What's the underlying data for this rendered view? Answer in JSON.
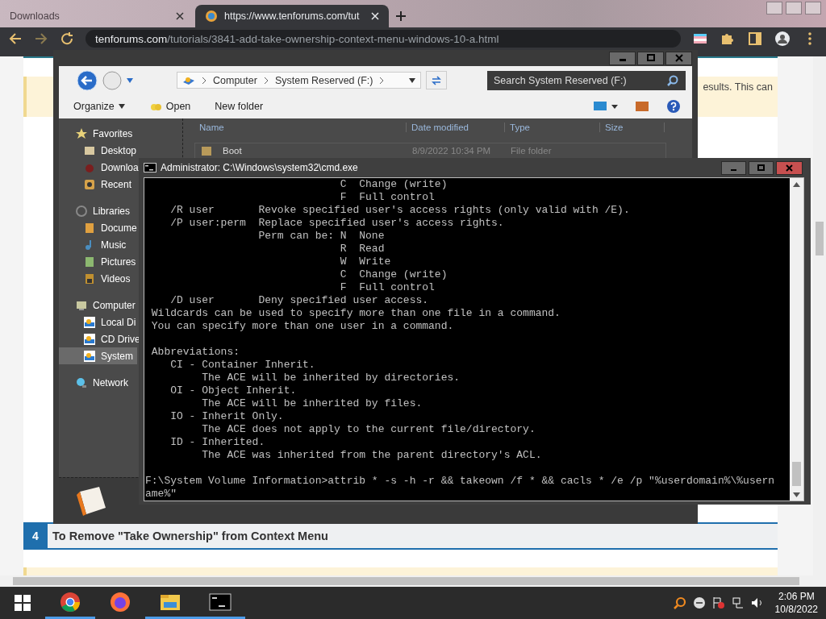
{
  "browser": {
    "tabs": [
      {
        "title": "Downloads",
        "selected": false
      },
      {
        "title": "https://www.tenforums.com/tut",
        "selected": true
      }
    ],
    "address_host": "tenforums.com",
    "address_path": "/tutorials/3841-add-take-ownership-context-menu-windows-10-a.html"
  },
  "page": {
    "note_text": "esults. This can",
    "section": {
      "number": "4",
      "title": "To Remove \"Take Ownership\" from Context Menu"
    }
  },
  "explorer": {
    "breadcrumb": [
      "Computer",
      "System Reserved (F:)"
    ],
    "search_placeholder": "Search System Reserved (F:)",
    "toolbar": [
      {
        "label": "Organize",
        "kind": "menu"
      },
      {
        "label": "Open",
        "kind": "open"
      },
      {
        "label": "New folder",
        "kind": "plain"
      }
    ],
    "columns": [
      "Name",
      "Date modified",
      "Type",
      "Size"
    ],
    "rows": [
      {
        "name": "Boot",
        "date": "8/9/2022 10:34 PM",
        "type": "File folder"
      }
    ],
    "sidebar": [
      {
        "label": "Favorites",
        "kind": "star",
        "selected": false,
        "children": [
          {
            "label": "Desktop",
            "kind": "desktop",
            "selected": false
          },
          {
            "label": "Downloa",
            "kind": "download",
            "selected": false
          },
          {
            "label": "Recent",
            "kind": "recent",
            "selected": false
          }
        ]
      },
      {
        "label": "Libraries",
        "kind": "library",
        "selected": false,
        "children": [
          {
            "label": "Docume",
            "kind": "documents",
            "selected": false
          },
          {
            "label": "Music",
            "kind": "music",
            "selected": false
          },
          {
            "label": "Pictures",
            "kind": "pictures",
            "selected": false
          },
          {
            "label": "Videos",
            "kind": "videos",
            "selected": false
          }
        ]
      },
      {
        "label": "Computer",
        "kind": "computer",
        "selected": false,
        "children": [
          {
            "label": "Local Di",
            "kind": "drive",
            "selected": false
          },
          {
            "label": "CD Drive",
            "kind": "drive",
            "selected": false
          },
          {
            "label": "System",
            "kind": "drive",
            "selected": true
          }
        ]
      },
      {
        "label": "Network",
        "kind": "network",
        "selected": false
      }
    ]
  },
  "cmd": {
    "title": "Administrator: C:\\Windows\\system32\\cmd.exe",
    "blocks": [
      [
        "                               C  Change (write)",
        "                               F  Full control",
        "    /R user       Revoke specified user's access rights (only valid with /E).",
        "    /P user:perm  Replace specified user's access rights.",
        "                  Perm can be: N  None",
        "                               R  Read",
        "                               W  Write",
        "                               C  Change (write)",
        "                               F  Full control",
        "    /D user       Deny specified user access.",
        " Wildcards can be used to specify more than one file in a command.",
        " You can specify more than one user in a command."
      ],
      [
        " Abbreviations:",
        "    CI - Container Inherit.",
        "         The ACE will be inherited by directories.",
        "    OI - Object Inherit.",
        "         The ACE will be inherited by files.",
        "    IO - Inherit Only.",
        "         The ACE does not apply to the current file/directory.",
        "    ID - Inherited.",
        "         The ACE was inherited from the parent directory's ACL."
      ],
      [
        "F:\\System Volume Information>attrib * -s -h -r && takeown /f * && cacls * /e /p \"%userdomain%\\%usern",
        "ame%\""
      ]
    ]
  },
  "taskbar": {
    "apps": [
      {
        "kind": "chrome",
        "running": true
      },
      {
        "kind": "firefox",
        "running": false
      },
      {
        "kind": "explorer",
        "running": true
      },
      {
        "kind": "terminal",
        "running": true
      }
    ],
    "time": "2:06 PM",
    "date": "10/8/2022"
  }
}
